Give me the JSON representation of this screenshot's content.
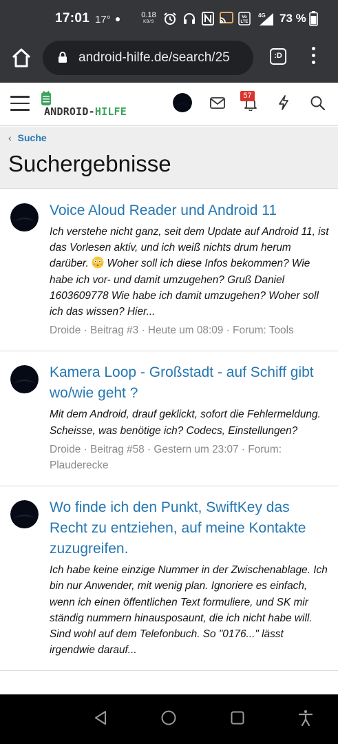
{
  "status_bar": {
    "time": "17:01",
    "temperature": "17°",
    "net_speed_value": "0.18",
    "net_speed_unit": "KB/S",
    "battery_percent": "73 %",
    "icons": [
      "alarm-icon",
      "headphones-icon",
      "nfc-icon",
      "cast-icon",
      "volte-icon",
      "4g-signal-icon",
      "battery-icon"
    ]
  },
  "browser": {
    "url": "android-hilfe.de/search/25",
    "tabs_label": ":D"
  },
  "site_header": {
    "logo_text_part1": "ANDROID-",
    "logo_text_part2": "HILFE",
    "notification_count": "57"
  },
  "breadcrumb": {
    "label": "Suche"
  },
  "page": {
    "title": "Suchergebnisse"
  },
  "results": [
    {
      "title": "Voice Aloud Reader und Android 11",
      "snippet_before_emoji": "Ich verstehe nicht ganz, seit dem Update auf Android 11, ist das Vorlesen aktiv, und ich weiß nichts drum herum darüber.",
      "snippet_after_emoji": "Woher soll ich diese Infos bekommen? Wie habe ich vor- und damit umzugehen? Gruß Daniel 1603609778 Wie habe ich damit umzugehen? Woher soll ich das wissen? Hier...",
      "meta": "Droide · Beitrag #3 · Heute um 08:09 · Forum: Tools"
    },
    {
      "title": "Kamera Loop - Großstadt - auf Schiff gibt wo/wie geht ?",
      "snippet": "Mit dem Android, drauf geklickt, sofort die Fehlermeldung. Scheisse, was benötige ich? Codecs, Einstellungen?",
      "meta": "Droide · Beitrag #58 · Gestern um 23:07 · Forum: Plauderecke"
    },
    {
      "title": "Wo finde ich den Punkt, SwiftKey das Recht zu entziehen, auf meine Kontakte zuzugreifen.",
      "snippet": "Ich habe keine einzige Nummer in der Zwischenablage. Ich bin nur Anwender, mit wenig plan. Ignoriere es einfach, wenn ich einen öffentlichen Text formuliere, und SK mir ständig nummern hinausposaunt, die ich nicht habe will. Sind wohl auf dem Telefonbuch. So \"0176...\" lässt irgendwie darauf..."
    }
  ],
  "colors": {
    "chrome_bg": "#35363a",
    "link": "#2577b1",
    "logo_green": "#3ca35b",
    "badge_red": "#d9342b",
    "meta_gray": "#8a8a8a"
  }
}
